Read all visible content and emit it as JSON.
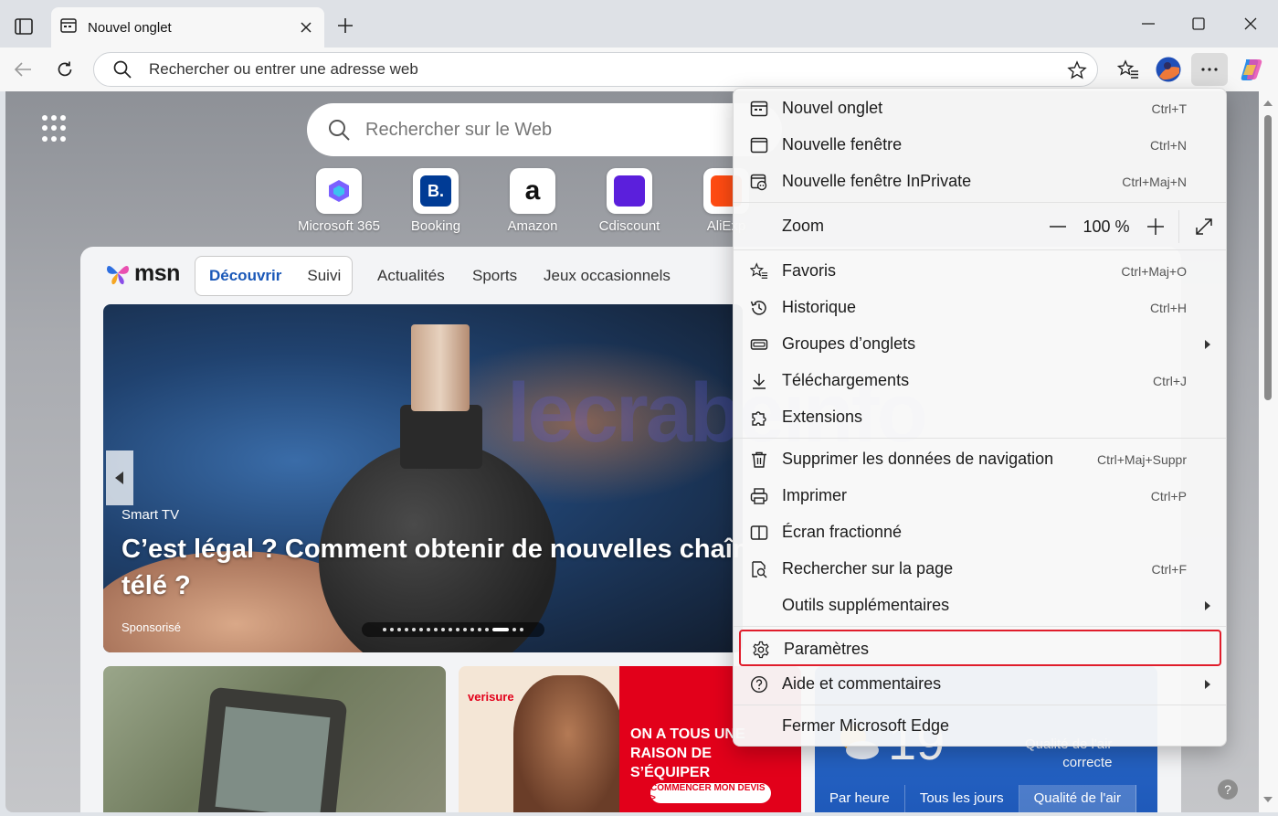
{
  "browser": {
    "tab": {
      "title": "Nouvel onglet"
    },
    "address_bar": {
      "placeholder": "Rechercher ou entrer une adresse web"
    }
  },
  "newtab": {
    "search": {
      "placeholder": "Rechercher sur le Web"
    },
    "quicklinks": [
      {
        "label": "Microsoft 365",
        "icon": "microsoft365-icon"
      },
      {
        "label": "Booking",
        "icon": "booking-icon"
      },
      {
        "label": "Amazon",
        "icon": "amazon-icon"
      },
      {
        "label": "Cdiscount",
        "icon": "cdiscount-icon"
      },
      {
        "label": "AliExp",
        "icon": "aliexpress-icon"
      }
    ],
    "msn": {
      "logo": "msn",
      "toggle": [
        "Découvrir",
        "Suivi"
      ],
      "nav": [
        "Actualités",
        "Sports",
        "Jeux occasionnels"
      ],
      "hero": {
        "category": "Smart TV",
        "title": "C’est légal ? Comment obtenir de nouvelles chaîn\ntélé ?",
        "sponsor": "Sponsorisé"
      },
      "ad": {
        "brand": "verisure",
        "text": "ON A TOUS UNE\nRAISON DE S’ÉQUIPER",
        "cta": "COMMENCER MON DEVIS >"
      },
      "weather": {
        "temp": "19",
        "air": "Qualité de l'air\ncorrecte",
        "tabs": [
          "Par heure",
          "Tous les jours",
          "Qualité de l'air"
        ]
      }
    },
    "watermark": "lecrabeinfo"
  },
  "menu": {
    "items": [
      {
        "label": "Nouvel onglet",
        "shortcut": "Ctrl+T",
        "icon": "new-tab-icon"
      },
      {
        "label": "Nouvelle fenêtre",
        "shortcut": "Ctrl+N",
        "icon": "new-window-icon"
      },
      {
        "label": "Nouvelle fenêtre InPrivate",
        "shortcut": "Ctrl+Maj+N",
        "icon": "inprivate-icon"
      }
    ],
    "zoom": {
      "label": "Zoom",
      "value": "100 %"
    },
    "items2": [
      {
        "label": "Favoris",
        "shortcut": "Ctrl+Maj+O",
        "icon": "favorites-icon"
      },
      {
        "label": "Historique",
        "shortcut": "Ctrl+H",
        "icon": "history-icon"
      },
      {
        "label": "Groupes d’onglets",
        "shortcut": "",
        "icon": "tab-groups-icon"
      },
      {
        "label": "Téléchargements",
        "shortcut": "Ctrl+J",
        "icon": "download-icon"
      },
      {
        "label": "Extensions",
        "shortcut": "",
        "icon": "extensions-icon"
      }
    ],
    "items3": [
      {
        "label": "Supprimer les données de navigation",
        "shortcut": "Ctrl+Maj+Suppr",
        "icon": "trash-icon"
      },
      {
        "label": "Imprimer",
        "shortcut": "Ctrl+P",
        "icon": "print-icon"
      },
      {
        "label": "Écran fractionné",
        "shortcut": "",
        "icon": "split-screen-icon"
      },
      {
        "label": "Rechercher sur la page",
        "shortcut": "Ctrl+F",
        "icon": "find-icon"
      },
      {
        "label": "Outils supplémentaires",
        "shortcut": "",
        "icon": "more-tools-icon"
      }
    ],
    "settings": {
      "label": "Paramètres",
      "icon": "gear-icon"
    },
    "help": {
      "label": "Aide et commentaires",
      "icon": "help-icon"
    },
    "close": {
      "label": "Fermer Microsoft Edge"
    }
  },
  "colors": {
    "highlight": "#e01d2b",
    "accent": "#1a58b8"
  }
}
